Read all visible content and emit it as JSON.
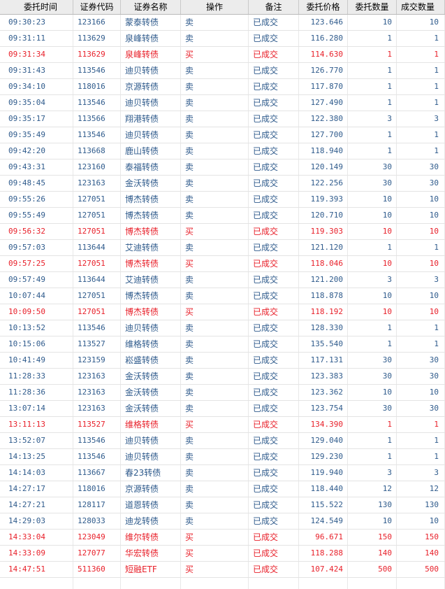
{
  "header": [
    "委托时间",
    "证券代码",
    "证券名称",
    "操作",
    "备注",
    "委托价格",
    "委托数量",
    "成交数量"
  ],
  "rows": [
    {
      "time": "09:30:23",
      "code": "123166",
      "name": "蒙泰转债",
      "side": "卖",
      "note": "已成交",
      "price": "123.646",
      "qty": "10",
      "filled": "10"
    },
    {
      "time": "09:31:11",
      "code": "113629",
      "name": "泉峰转债",
      "side": "卖",
      "note": "已成交",
      "price": "116.280",
      "qty": "1",
      "filled": "1"
    },
    {
      "time": "09:31:34",
      "code": "113629",
      "name": "泉峰转债",
      "side": "买",
      "note": "已成交",
      "price": "114.630",
      "qty": "1",
      "filled": "1"
    },
    {
      "time": "09:31:43",
      "code": "113546",
      "name": "迪贝转债",
      "side": "卖",
      "note": "已成交",
      "price": "126.770",
      "qty": "1",
      "filled": "1"
    },
    {
      "time": "09:34:10",
      "code": "118016",
      "name": "京源转债",
      "side": "卖",
      "note": "已成交",
      "price": "117.870",
      "qty": "1",
      "filled": "1"
    },
    {
      "time": "09:35:04",
      "code": "113546",
      "name": "迪贝转债",
      "side": "卖",
      "note": "已成交",
      "price": "127.490",
      "qty": "1",
      "filled": "1"
    },
    {
      "time": "09:35:17",
      "code": "113566",
      "name": "翔港转债",
      "side": "卖",
      "note": "已成交",
      "price": "122.380",
      "qty": "3",
      "filled": "3"
    },
    {
      "time": "09:35:49",
      "code": "113546",
      "name": "迪贝转债",
      "side": "卖",
      "note": "已成交",
      "price": "127.700",
      "qty": "1",
      "filled": "1"
    },
    {
      "time": "09:42:20",
      "code": "113668",
      "name": "鹿山转债",
      "side": "卖",
      "note": "已成交",
      "price": "118.940",
      "qty": "1",
      "filled": "1"
    },
    {
      "time": "09:43:31",
      "code": "123160",
      "name": "泰福转债",
      "side": "卖",
      "note": "已成交",
      "price": "120.149",
      "qty": "30",
      "filled": "30"
    },
    {
      "time": "09:48:45",
      "code": "123163",
      "name": "金沃转债",
      "side": "卖",
      "note": "已成交",
      "price": "122.256",
      "qty": "30",
      "filled": "30"
    },
    {
      "time": "09:55:26",
      "code": "127051",
      "name": "博杰转债",
      "side": "卖",
      "note": "已成交",
      "price": "119.393",
      "qty": "10",
      "filled": "10"
    },
    {
      "time": "09:55:49",
      "code": "127051",
      "name": "博杰转债",
      "side": "卖",
      "note": "已成交",
      "price": "120.710",
      "qty": "10",
      "filled": "10"
    },
    {
      "time": "09:56:32",
      "code": "127051",
      "name": "博杰转债",
      "side": "买",
      "note": "已成交",
      "price": "119.303",
      "qty": "10",
      "filled": "10"
    },
    {
      "time": "09:57:03",
      "code": "113644",
      "name": "艾迪转债",
      "side": "卖",
      "note": "已成交",
      "price": "121.120",
      "qty": "1",
      "filled": "1"
    },
    {
      "time": "09:57:25",
      "code": "127051",
      "name": "博杰转债",
      "side": "买",
      "note": "已成交",
      "price": "118.046",
      "qty": "10",
      "filled": "10"
    },
    {
      "time": "09:57:49",
      "code": "113644",
      "name": "艾迪转债",
      "side": "卖",
      "note": "已成交",
      "price": "121.200",
      "qty": "3",
      "filled": "3"
    },
    {
      "time": "10:07:44",
      "code": "127051",
      "name": "博杰转债",
      "side": "卖",
      "note": "已成交",
      "price": "118.878",
      "qty": "10",
      "filled": "10"
    },
    {
      "time": "10:09:50",
      "code": "127051",
      "name": "博杰转债",
      "side": "买",
      "note": "已成交",
      "price": "118.192",
      "qty": "10",
      "filled": "10"
    },
    {
      "time": "10:13:52",
      "code": "113546",
      "name": "迪贝转债",
      "side": "卖",
      "note": "已成交",
      "price": "128.330",
      "qty": "1",
      "filled": "1"
    },
    {
      "time": "10:15:06",
      "code": "113527",
      "name": "维格转债",
      "side": "卖",
      "note": "已成交",
      "price": "135.540",
      "qty": "1",
      "filled": "1"
    },
    {
      "time": "10:41:49",
      "code": "123159",
      "name": "崧盛转债",
      "side": "卖",
      "note": "已成交",
      "price": "117.131",
      "qty": "30",
      "filled": "30"
    },
    {
      "time": "11:28:33",
      "code": "123163",
      "name": "金沃转债",
      "side": "卖",
      "note": "已成交",
      "price": "123.383",
      "qty": "30",
      "filled": "30"
    },
    {
      "time": "11:28:36",
      "code": "123163",
      "name": "金沃转债",
      "side": "卖",
      "note": "已成交",
      "price": "123.362",
      "qty": "10",
      "filled": "10"
    },
    {
      "time": "13:07:14",
      "code": "123163",
      "name": "金沃转债",
      "side": "卖",
      "note": "已成交",
      "price": "123.754",
      "qty": "30",
      "filled": "30"
    },
    {
      "time": "13:11:13",
      "code": "113527",
      "name": "维格转债",
      "side": "买",
      "note": "已成交",
      "price": "134.390",
      "qty": "1",
      "filled": "1"
    },
    {
      "time": "13:52:07",
      "code": "113546",
      "name": "迪贝转债",
      "side": "卖",
      "note": "已成交",
      "price": "129.040",
      "qty": "1",
      "filled": "1"
    },
    {
      "time": "14:13:25",
      "code": "113546",
      "name": "迪贝转债",
      "side": "卖",
      "note": "已成交",
      "price": "129.230",
      "qty": "1",
      "filled": "1"
    },
    {
      "time": "14:14:03",
      "code": "113667",
      "name": "春23转债",
      "side": "卖",
      "note": "已成交",
      "price": "119.940",
      "qty": "3",
      "filled": "3"
    },
    {
      "time": "14:27:17",
      "code": "118016",
      "name": "京源转债",
      "side": "卖",
      "note": "已成交",
      "price": "118.440",
      "qty": "12",
      "filled": "12"
    },
    {
      "time": "14:27:21",
      "code": "128117",
      "name": "道恩转债",
      "side": "卖",
      "note": "已成交",
      "price": "115.522",
      "qty": "130",
      "filled": "130"
    },
    {
      "time": "14:29:03",
      "code": "128033",
      "name": "迪龙转债",
      "side": "卖",
      "note": "已成交",
      "price": "124.549",
      "qty": "10",
      "filled": "10"
    },
    {
      "time": "14:33:04",
      "code": "123049",
      "name": "维尔转债",
      "side": "买",
      "note": "已成交",
      "price": "96.671",
      "qty": "150",
      "filled": "150"
    },
    {
      "time": "14:33:09",
      "code": "127077",
      "name": "华宏转债",
      "side": "买",
      "note": "已成交",
      "price": "118.288",
      "qty": "140",
      "filled": "140"
    },
    {
      "time": "14:47:51",
      "code": "511360",
      "name": "短融ETF",
      "side": "买",
      "note": "已成交",
      "price": "107.424",
      "qty": "500",
      "filled": "500"
    }
  ],
  "colors": {
    "sell": "#2f5b8c",
    "buy": "#e8202a",
    "header_bg": "#ececec"
  }
}
